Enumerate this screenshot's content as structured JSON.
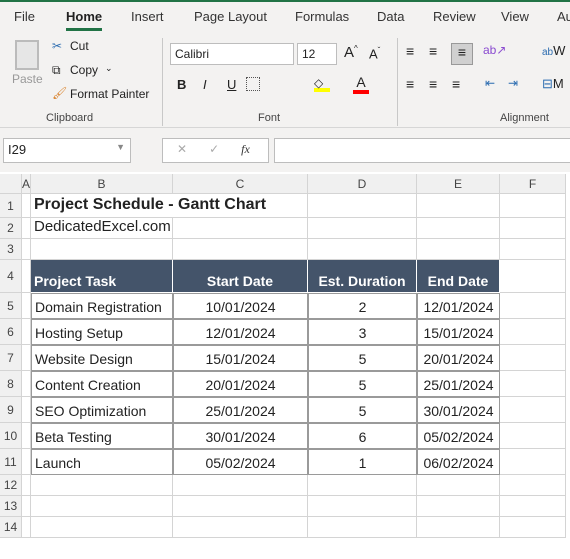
{
  "ribbon_tabs": [
    "File",
    "Home",
    "Insert",
    "Page Layout",
    "Formulas",
    "Data",
    "Review",
    "View",
    "Au"
  ],
  "active_tab": "Home",
  "clipboard": {
    "paste": "Paste",
    "cut": "Cut",
    "copy": "Copy",
    "format_painter": "Format Painter",
    "group": "Clipboard"
  },
  "font": {
    "name": "Calibri",
    "size": "12",
    "group": "Font",
    "bold": "B",
    "italic": "I",
    "underline": "U",
    "fill_color": "#ffff00",
    "font_color": "#ff0000"
  },
  "alignment": {
    "group": "Alignment",
    "wrap": "W",
    "merge": "M"
  },
  "formula_bar": {
    "name_box": "I29",
    "fx": "fx",
    "value": ""
  },
  "columns": [
    "A",
    "B",
    "C",
    "D",
    "E",
    "F"
  ],
  "rows": [
    "1",
    "2",
    "3",
    "4",
    "5",
    "6",
    "7",
    "8",
    "9",
    "10",
    "11",
    "12",
    "13",
    "14"
  ],
  "sheet": {
    "title": "Project Schedule - Gantt Chart",
    "subtitle": "DedicatedExcel.com",
    "headers": [
      "Project Task",
      "Start Date",
      "Est. Duration",
      "End Date"
    ],
    "header_fill": "#44546a",
    "tasks": [
      [
        "Domain Registration",
        "10/01/2024",
        "2",
        "12/01/2024"
      ],
      [
        "Hosting Setup",
        "12/01/2024",
        "3",
        "15/01/2024"
      ],
      [
        "Website Design",
        "15/01/2024",
        "5",
        "20/01/2024"
      ],
      [
        "Content Creation",
        "20/01/2024",
        "5",
        "25/01/2024"
      ],
      [
        "SEO Optimization",
        "25/01/2024",
        "5",
        "30/01/2024"
      ],
      [
        "Beta Testing",
        "30/01/2024",
        "6",
        "05/02/2024"
      ],
      [
        "Launch",
        "05/02/2024",
        "1",
        "06/02/2024"
      ]
    ]
  }
}
